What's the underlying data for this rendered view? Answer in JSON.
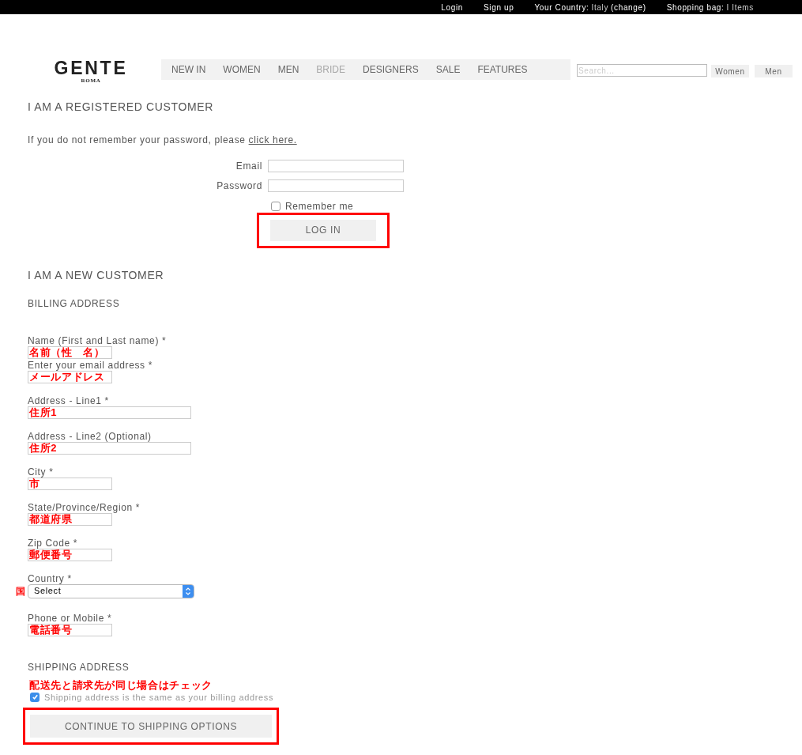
{
  "top_bar": {
    "links": [
      {
        "kind": "link",
        "text": "Login"
      },
      {
        "kind": "link",
        "text": "Sign up"
      },
      {
        "kind": "country",
        "label": "Your Country:",
        "value": "Italy",
        "action": "(change)"
      },
      {
        "kind": "bag",
        "label": "Shopping bag:",
        "value": "I Items"
      }
    ]
  },
  "logo": {
    "name": "GENTE",
    "sub": "ROMA"
  },
  "nav": [
    {
      "label": "NEW IN",
      "disabled": false
    },
    {
      "label": "WOMEN",
      "disabled": false
    },
    {
      "label": "MEN",
      "disabled": false
    },
    {
      "label": "BRIDE",
      "disabled": true
    },
    {
      "label": "DESIGNERS",
      "disabled": false
    },
    {
      "label": "SALE",
      "disabled": false
    },
    {
      "label": "FEATURES",
      "disabled": false
    }
  ],
  "search": {
    "placeholder": "Search...",
    "buttons": [
      "Women",
      "Men"
    ]
  },
  "registered": {
    "heading": "I AM A REGISTERED CUSTOMER",
    "hint": "If you do not remember your password, please",
    "link": "click here.",
    "fields": [
      {
        "label": "Email"
      },
      {
        "label": "Password"
      }
    ],
    "remember": {
      "label": "Remember me",
      "checked": false
    },
    "button": {
      "label": "LOG IN",
      "highlighted": true
    }
  },
  "new_customer": {
    "heading": "I AM A NEW CUSTOMER",
    "billing_heading": "BILLING ADDRESS",
    "fields": [
      {
        "kind": "short",
        "label": "Name (First and Last name) *",
        "value": "名前（性　名）"
      },
      {
        "kind": "short",
        "label": "Enter your email address *",
        "value": "メールアドレス"
      },
      {
        "kind": "long",
        "label": "Address - Line1 *",
        "value": "住所1"
      },
      {
        "kind": "long",
        "label": "Address - Line2 (Optional)",
        "value": "住所2"
      },
      {
        "kind": "short",
        "label": "City *",
        "value": "市"
      },
      {
        "kind": "short",
        "label": "State/Province/Region *",
        "value": "都道府県"
      },
      {
        "kind": "short",
        "label": "Zip Code *",
        "value": "郵便番号"
      },
      {
        "kind": "select",
        "label": "Country *",
        "note": "国",
        "value": "Select"
      },
      {
        "kind": "short",
        "label": "Phone or Mobile *",
        "value": "電話番号"
      }
    ],
    "shipping_heading": "SHIPPING ADDRESS",
    "shipping_note": "配送先と請求先が同じ場合はチェック",
    "same_address": {
      "label": "Shipping address is the same as your billing address",
      "checked": true
    },
    "button": {
      "label": "CONTINUE TO SHIPPING OPTIONS",
      "highlighted": true
    }
  }
}
